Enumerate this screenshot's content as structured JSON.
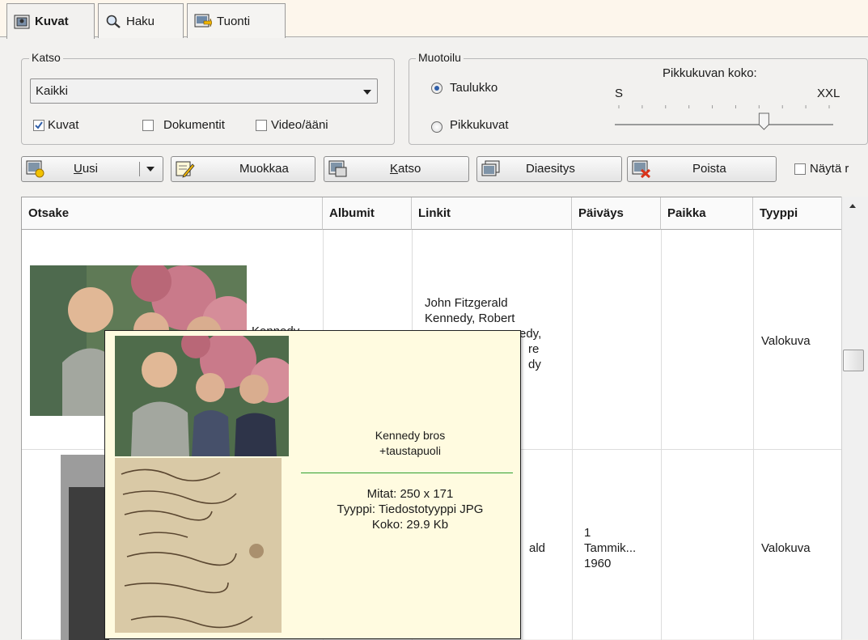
{
  "tabs": [
    {
      "label": "Kuvat",
      "icon": "photo-icon",
      "active": true
    },
    {
      "label": "Haku",
      "icon": "search-icon",
      "active": false
    },
    {
      "label": "Tuonti",
      "icon": "import-icon",
      "active": false
    }
  ],
  "katso": {
    "legend": "Katso",
    "filter_value": "Kaikki",
    "checkboxes": [
      {
        "label": "Kuvat",
        "checked": true
      },
      {
        "label": "Dokumentit",
        "checked": false
      },
      {
        "label": "Video/ääni",
        "checked": false
      }
    ]
  },
  "muotoilu": {
    "legend": "Muotoilu",
    "options": [
      {
        "label": "Taulukko",
        "selected": true
      },
      {
        "label": "Pikkukuvat",
        "selected": false
      }
    ],
    "thumb_size_label": "Pikkukuvan koko:",
    "slider_min_label": "S",
    "slider_max_label": "XXL",
    "slider_level": 0.69
  },
  "toolbar": {
    "new": "Uusi",
    "new_accesskey": "U",
    "edit": "Muokkaa",
    "view": "Katso",
    "view_accesskey": "K",
    "slideshow": "Diaesitys",
    "delete": "Poista",
    "show_checkbox": "Näytä r"
  },
  "table": {
    "columns": [
      "Otsake",
      "Albumit",
      "Linkit",
      "Päiväys",
      "Paikka",
      "Tyyppi"
    ],
    "rows": [
      {
        "title": "Kennedy",
        "albums": "",
        "links": [
          "John Fitzgerald",
          "Kennedy, Robert",
          "edy,",
          "re",
          "dy"
        ],
        "date": [
          "",
          "",
          ""
        ],
        "place": "",
        "type": "Valokuva"
      },
      {
        "title": "",
        "albums": "",
        "links": [
          "ald"
        ],
        "date": [
          "1",
          "Tammik...",
          "1960"
        ],
        "place": "",
        "type": "Valokuva"
      }
    ]
  },
  "tooltip": {
    "title_line1": "Kennedy bros",
    "title_line2": "+taustapuoli",
    "dimensions": "Mitat: 250 x 171",
    "file_type": "Tyyppi: Tiedostotyyppi JPG",
    "size": "Koko: 29.9 Kb",
    "divider_color": "#2ea02e"
  },
  "colors": {
    "accent_blue": "#2f5ea8",
    "tooltip_bg": "#fffbe0",
    "divider_green": "#2ea02e"
  }
}
